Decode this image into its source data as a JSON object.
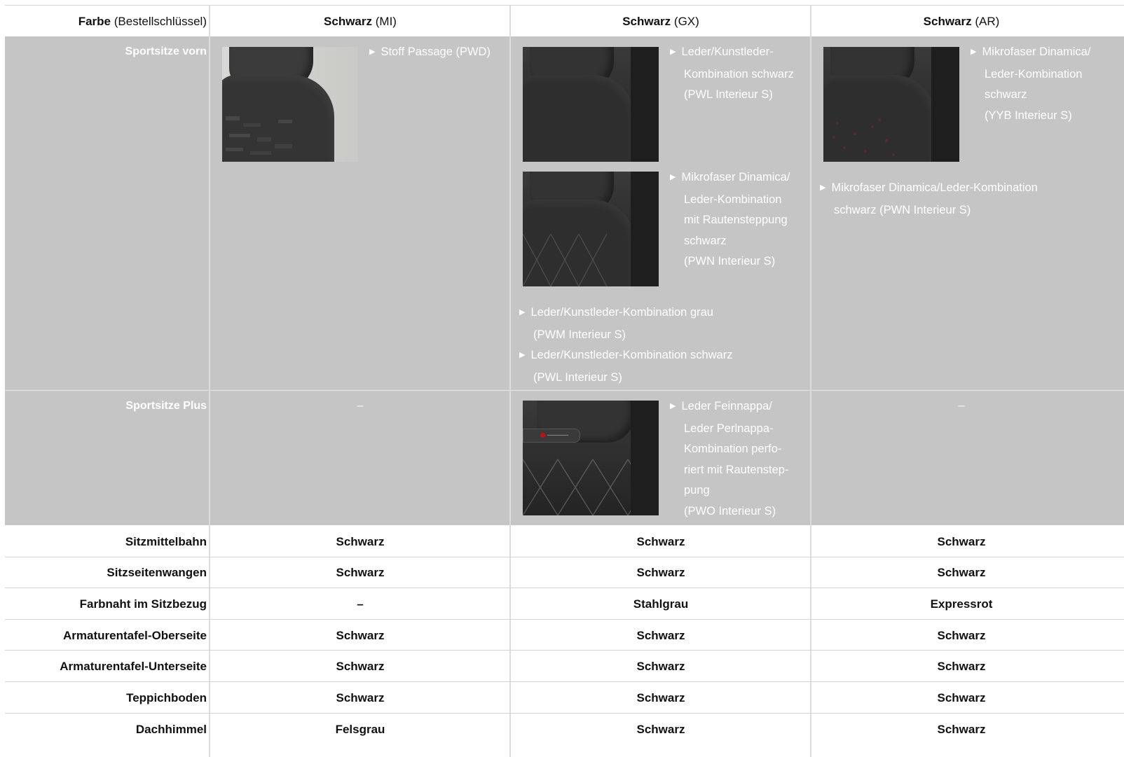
{
  "header": {
    "label_bold": "Farbe",
    "label_normal": "(Bestellschlüssel)",
    "columns": [
      {
        "bold": "Schwarz",
        "code": "(MI)"
      },
      {
        "bold": "Schwarz",
        "code": "(GX)"
      },
      {
        "bold": "Schwarz",
        "code": "(AR)"
      }
    ]
  },
  "sportsitze_vorn": {
    "label": "Sportsitze vorn",
    "col1": {
      "items": [
        "Stoff Passage (PWD)"
      ]
    },
    "col2": {
      "image1_desc": [
        "Leder/Kunstleder-",
        "Kombination schwarz",
        "(PWL Interieur S)"
      ],
      "image2_desc": [
        "Mikrofaser Dinamica/",
        "Leder-Kombination",
        "mit Rautensteppung",
        "schwarz",
        "(PWN Interieur S)"
      ],
      "extra_items": [
        [
          "Leder/Kunstleder-Kombination grau",
          "(PWM Interieur S)"
        ],
        [
          "Leder/Kunstleder-Kombination schwarz",
          "(PWL Interieur S)"
        ]
      ]
    },
    "col3": {
      "image_desc": [
        "Mikrofaser Dinamica/",
        "Leder-Kombination",
        "schwarz",
        "(YYB Interieur S)"
      ],
      "extra_items": [
        [
          "Mikrofaser Dinamica/Leder-Kombination",
          "schwarz (PWN Interieur S)"
        ]
      ]
    }
  },
  "sportsitze_plus": {
    "label": "Sportsitze Plus",
    "col1": "–",
    "col2": [
      "Leder Feinnappa/",
      "Leder Perlnappa-",
      "Kombination perfo-",
      "riert mit Rautenstep-",
      "pung",
      "(PWO Interieur S)"
    ],
    "col3": "–"
  },
  "rows": [
    {
      "label": "Sitzmittelbahn",
      "values": [
        "Schwarz",
        "Schwarz",
        "Schwarz"
      ]
    },
    {
      "label": "Sitzseitenwangen",
      "values": [
        "Schwarz",
        "Schwarz",
        "Schwarz"
      ]
    },
    {
      "label": "Farbnaht im Sitzbezug",
      "values": [
        "–",
        "Stahlgrau",
        "Expressrot"
      ]
    },
    {
      "label": "Armaturentafel-Oberseite",
      "values": [
        "Schwarz",
        "Schwarz",
        "Schwarz"
      ]
    },
    {
      "label": "Armaturentafel-Unterseite",
      "values": [
        "Schwarz",
        "Schwarz",
        "Schwarz"
      ]
    },
    {
      "label": "Teppichboden",
      "values": [
        "Schwarz",
        "Schwarz",
        "Schwarz"
      ]
    },
    {
      "label": "Dachhimmel",
      "values": [
        "Felsgrau",
        "Schwarz",
        "Schwarz"
      ]
    }
  ],
  "colors": {
    "band": "#c4c5c4",
    "grid": "#d3d3d3",
    "text": "#111111",
    "band_text": "#ffffff"
  }
}
